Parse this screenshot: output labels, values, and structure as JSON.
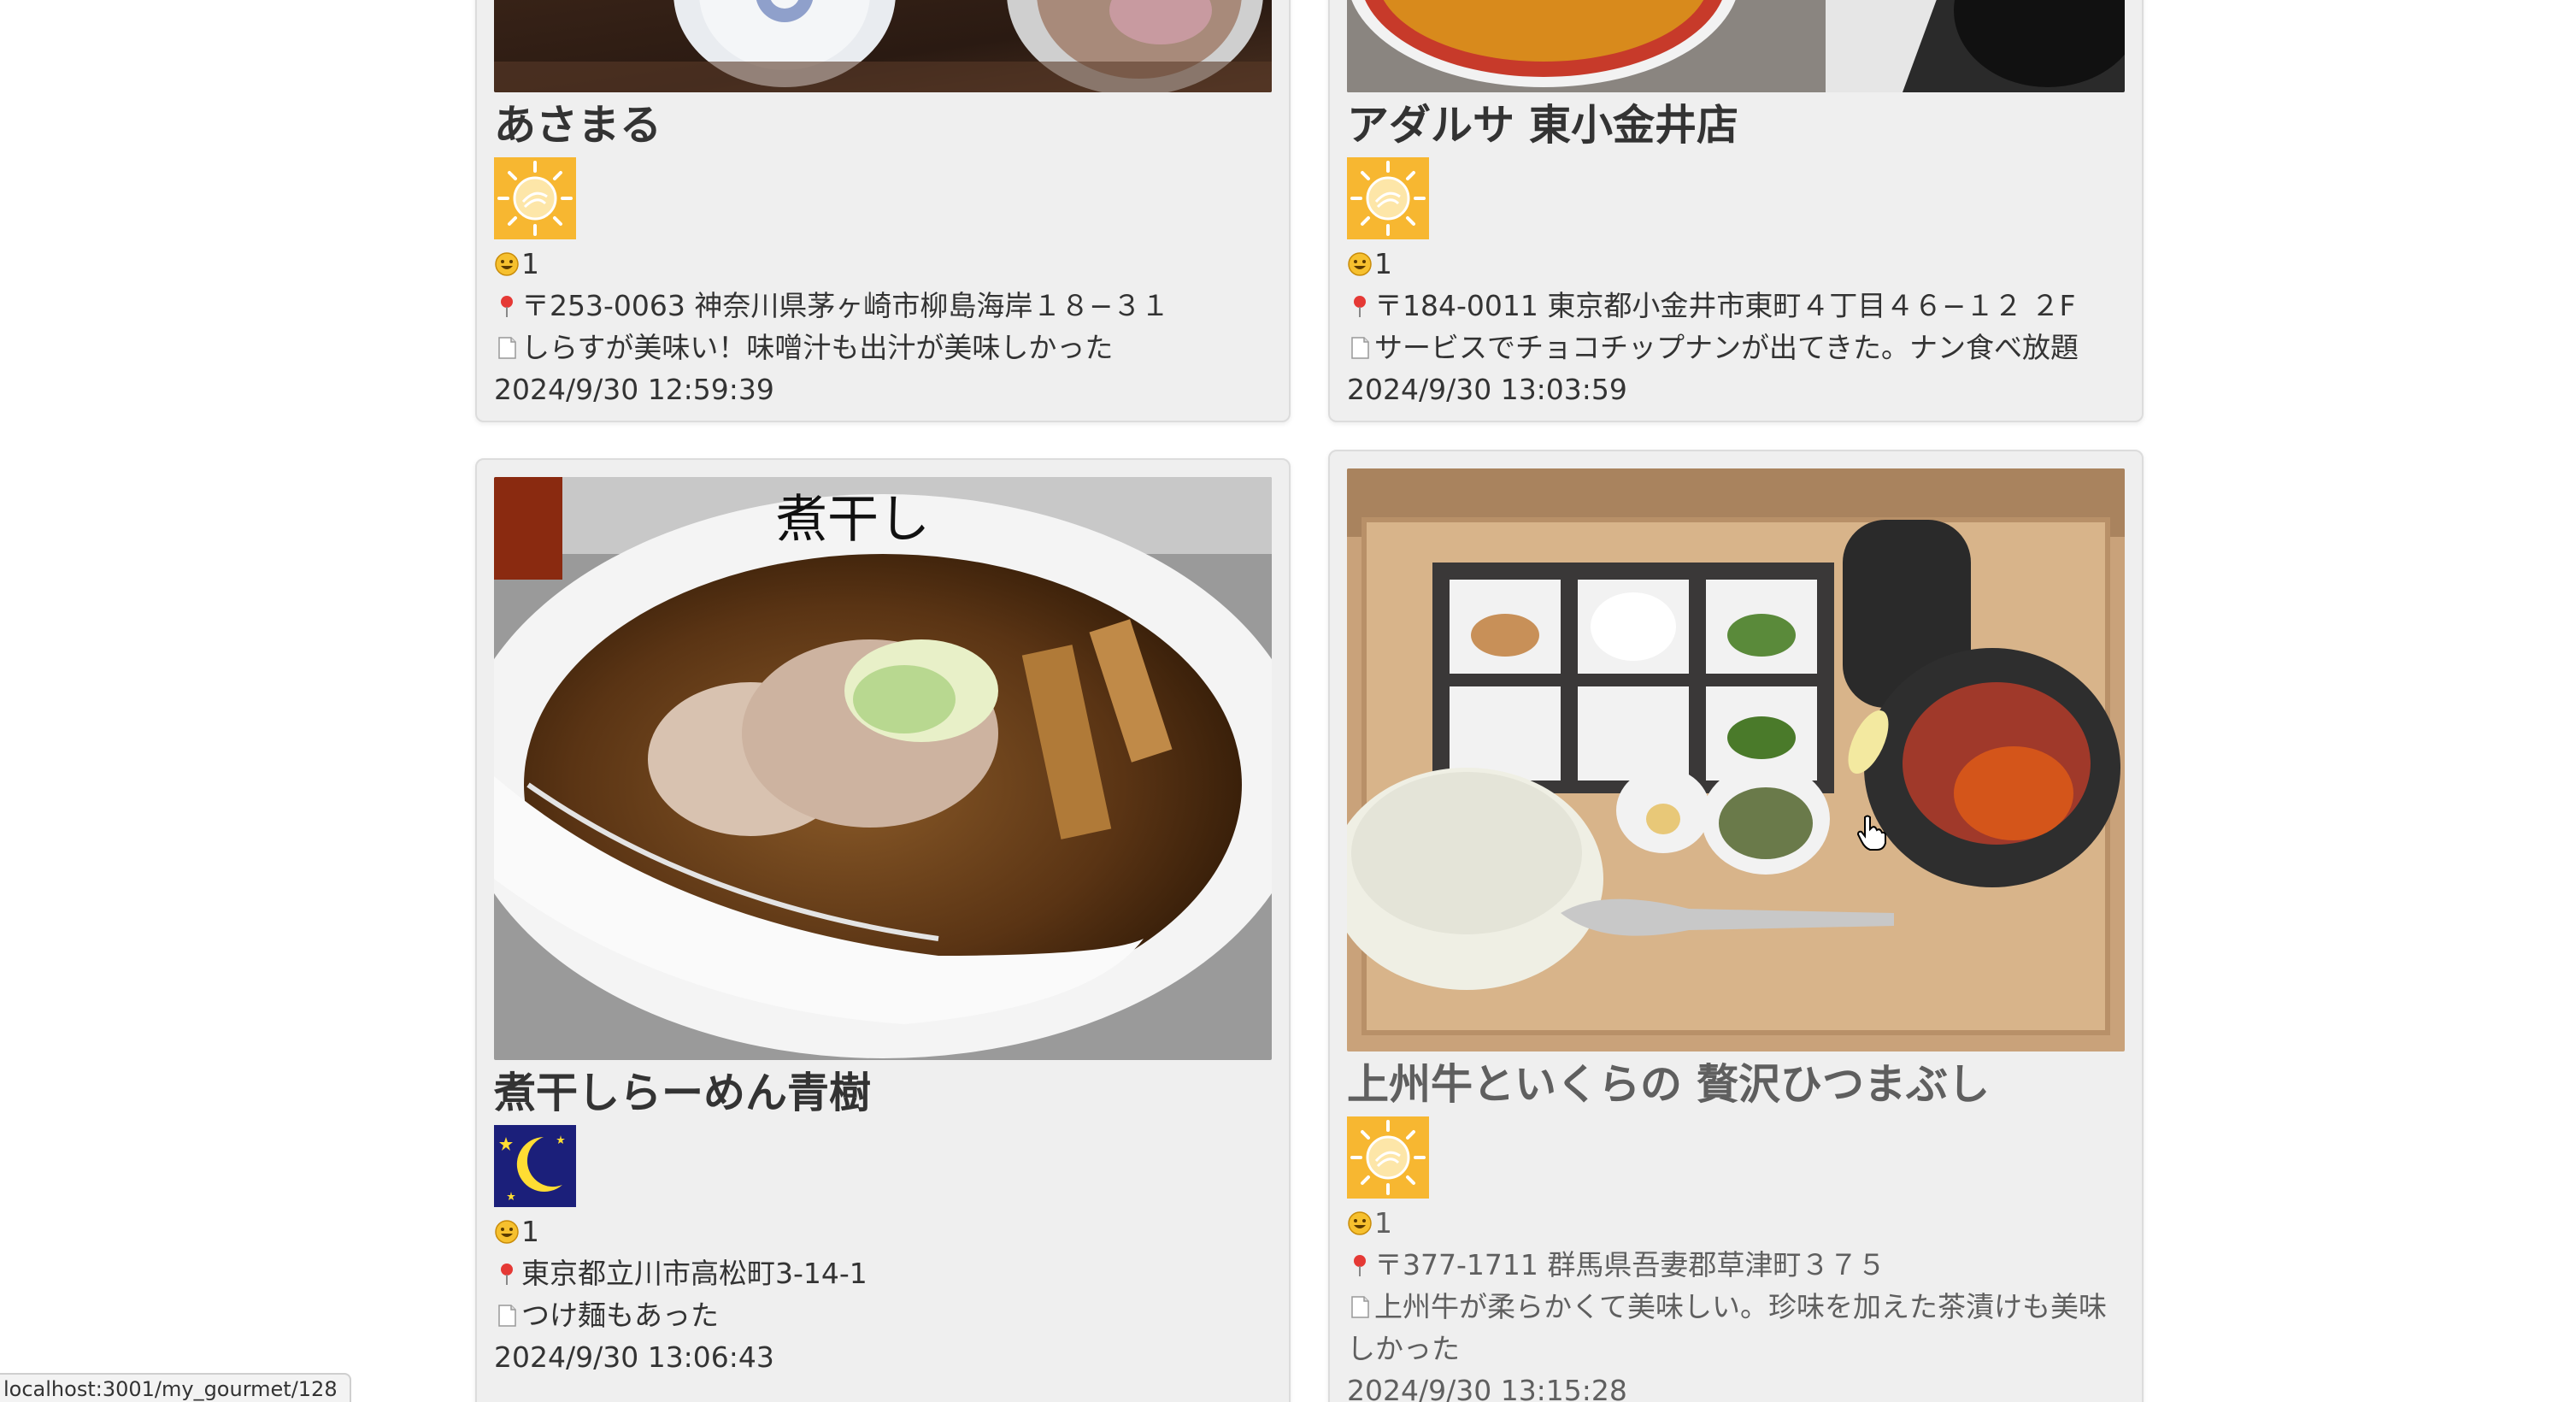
{
  "cards": [
    {
      "name": "あさまる",
      "weather_icon": "sun-icon",
      "smile_icon": "smile-emoji-icon",
      "rating": "1",
      "pin_icon": "pin-icon",
      "address": "〒253-0063 神奈川県茅ヶ崎市柳島海岸１８−３１",
      "memo_icon": "memo-icon",
      "memo": "しらすが美味い！味噌汁も出汁が美味しかった",
      "datetime": "2024/9/30 12:59:39"
    },
    {
      "name": "アダルサ 東小金井店",
      "weather_icon": "sun-icon",
      "smile_icon": "smile-emoji-icon",
      "rating": "1",
      "pin_icon": "pin-icon",
      "address": "〒184-0011 東京都小金井市東町４丁目４６−１２ ２F",
      "memo_icon": "memo-icon",
      "memo": "サービスでチョコチップナンが出てきた。ナン食べ放題",
      "datetime": "2024/9/30 13:03:59"
    },
    {
      "name": "煮干しらーめん青樹",
      "weather_icon": "moon-icon",
      "smile_icon": "smile-emoji-icon",
      "rating": "1",
      "pin_icon": "pin-icon",
      "address": "東京都立川市高松町3-14-1",
      "memo_icon": "memo-icon",
      "memo": "つけ麺もあった",
      "datetime": "2024/9/30 13:06:43"
    },
    {
      "name": "上州牛といくらの 贅沢ひつまぶし",
      "weather_icon": "sun-icon",
      "smile_icon": "smile-emoji-icon",
      "rating": "1",
      "pin_icon": "pin-icon",
      "address": "〒377-1711 群馬県吾妻郡草津町３７５",
      "memo_icon": "memo-icon",
      "memo": "上州牛が柔らかくて美味しい。珍味を加えた茶漬けも美味しかった",
      "datetime": "2024/9/30 13:15:28"
    }
  ],
  "status_bar": {
    "url": "localhost:3001/my_gourmet/128"
  },
  "colors": {
    "card_bg": "#efefef",
    "text": "#333333",
    "sun_bg": "#f7b731",
    "moon_bg": "#1b1f7a"
  }
}
